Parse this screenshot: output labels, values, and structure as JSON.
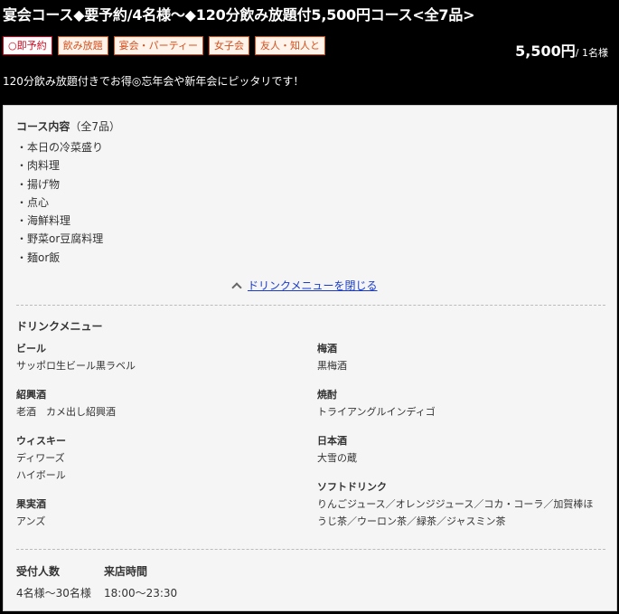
{
  "course": {
    "title": "宴会コース◆要予約/4名様～◆120分飲み放題付5,500円コース<全7品>",
    "price": "5,500円",
    "price_unit": "/ 1名様",
    "catch": "120分飲み放題付きでお得◎忘年会や新年会にピッタリです！"
  },
  "tags": [
    "○即予約",
    "飲み放題",
    "宴会・パーティー",
    "女子会",
    "友人・知人と"
  ],
  "contents": {
    "heading": "コース内容",
    "count": "（全7品）",
    "items": [
      "・本日の冷菜盛り",
      "・肉料理",
      "・揚げ物",
      "・点心",
      "・海鮮料理",
      "・野菜or豆腐料理",
      "・麺or飯"
    ]
  },
  "toggle": {
    "label": "ドリンクメニューを閉じる"
  },
  "drinks": {
    "heading": "ドリンクメニュー",
    "categories": [
      {
        "name": "ビール",
        "items": [
          "サッポロ生ビール黒ラベル"
        ]
      },
      {
        "name": "紹興酒",
        "items": [
          "老酒　カメ出し紹興酒"
        ]
      },
      {
        "name": "ウィスキー",
        "items": [
          "ディワーズ",
          "ハイボール"
        ]
      },
      {
        "name": "果実酒",
        "items": [
          "アンズ"
        ]
      },
      {
        "name": "梅酒",
        "items": [
          "黒梅酒"
        ]
      },
      {
        "name": "焼酎",
        "items": [
          "トライアングルインディゴ"
        ]
      },
      {
        "name": "日本酒",
        "items": [
          "大雪の蔵"
        ]
      },
      {
        "name": "ソフトドリンク",
        "items": [
          "りんごジュース／オレンジジュース／コカ・コーラ／加賀棒ほ",
          "うじ茶／ウーロン茶／緑茶／ジャスミン茶"
        ]
      }
    ]
  },
  "info": {
    "capacity_label": "受付人数",
    "capacity_value": "4名様～30名様",
    "time_label": "来店時間",
    "time_value": "18:00～23:30"
  },
  "colors": {
    "accent": "#d64f1b",
    "link": "#1a3cc9",
    "panel_bg": "#f5f5f5"
  }
}
